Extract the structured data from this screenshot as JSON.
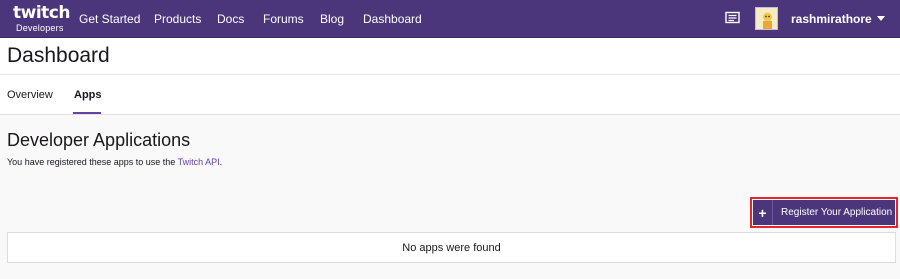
{
  "nav": {
    "logo_word": "twitch",
    "logo_sub": "Developers",
    "links": [
      "Get Started",
      "Products",
      "Docs",
      "Forums",
      "Blog",
      "Dashboard"
    ],
    "username": "rashmirathore",
    "brand_color": "#4b367c",
    "icons": [
      "messages-icon",
      "avatar",
      "chevron-down-icon"
    ]
  },
  "page": {
    "title": "Dashboard",
    "tabs": [
      {
        "label": "Overview",
        "active": false
      },
      {
        "label": "Apps",
        "active": true
      }
    ]
  },
  "apps": {
    "heading": "Developer Applications",
    "desc_prefix": "You have registered these apps to use the ",
    "desc_link": "Twitch API",
    "desc_suffix": ".",
    "register_label": "Register Your Application",
    "register_icon": "+",
    "empty_message": "No apps were found",
    "highlight_color": "#e3262b"
  }
}
